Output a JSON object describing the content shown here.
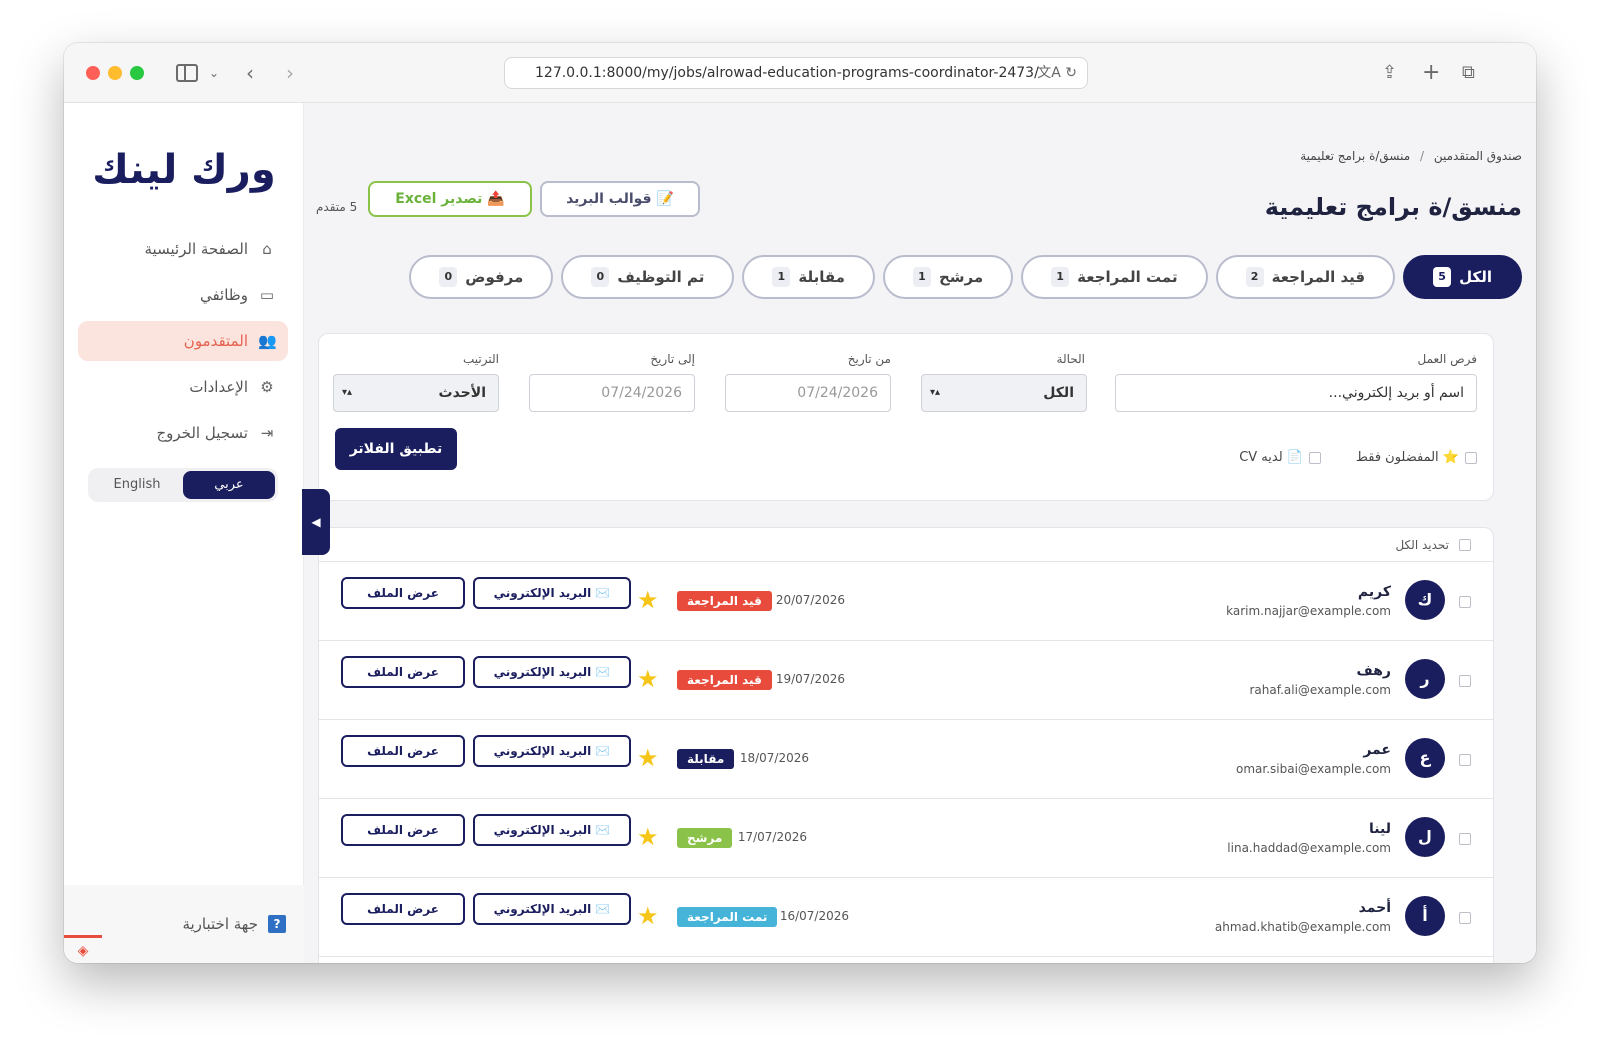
{
  "browser": {
    "url": "127.0.0.1:8000/my/jobs/alrowad-education-programs-coordinator-2473/"
  },
  "sidebar": {
    "logo": "ورك لينك",
    "items": [
      {
        "label": "الصفحة الرئيسية",
        "icon": "home-icon",
        "active": false
      },
      {
        "label": "وظائفي",
        "icon": "briefcase-icon",
        "active": false
      },
      {
        "label": "المتقدمون",
        "icon": "users-icon",
        "active": true
      },
      {
        "label": "الإعدادات",
        "icon": "gear-icon",
        "active": false
      },
      {
        "label": "تسجيل الخروج",
        "icon": "logout-icon",
        "active": false
      }
    ],
    "lang_ar": "عربي",
    "lang_en": "English",
    "footer_label": "جهة اختبارية"
  },
  "header": {
    "breadcrumb_root": "صندوق المتقدمين",
    "breadcrumb_sep": "/",
    "breadcrumb_current": "منسق/ة برامج تعليمية",
    "title": "منسق/ة برامج تعليمية",
    "templates_label": "📝 قوالب البريد",
    "excel_label": "📤 تصدير Excel",
    "count_text": "5 متقدم"
  },
  "tabs": [
    {
      "label": "الكل",
      "count": "5",
      "active": true
    },
    {
      "label": "قيد المراجعة",
      "count": "2",
      "active": false
    },
    {
      "label": "تمت المراجعة",
      "count": "1",
      "active": false
    },
    {
      "label": "مرشح",
      "count": "1",
      "active": false
    },
    {
      "label": "مقابلة",
      "count": "1",
      "active": false
    },
    {
      "label": "تم التوظيف",
      "count": "0",
      "active": false
    },
    {
      "label": "مرفوض",
      "count": "0",
      "active": false
    }
  ],
  "filters": {
    "job_label": "فرص العمل",
    "job_placeholder": "اسم أو بريد إلكتروني...",
    "status_label": "الحالة",
    "status_value": "الكل",
    "from_label": "من تاريخ",
    "from_placeholder": "07/24/2026",
    "to_label": "إلى تاريخ",
    "to_placeholder": "07/24/2026",
    "sort_label": "الترتيب",
    "sort_value": "الأحدث",
    "apply_label": "تطبيق الفلاتر",
    "favorites_label": "⭐ المفضلون فقط",
    "cv_label": "📄 لديه CV"
  },
  "list": {
    "select_all": "تحديد الكل",
    "email_label": "✉️ البريد الإلكتروني",
    "profile_label": "عرض الملف",
    "rows": [
      {
        "initial": "ك",
        "name": "كريم",
        "email": "karim.najjar@example.com",
        "date": "20/07/2026",
        "status": "قيد المراجعة",
        "status_color": "#e84b3c"
      },
      {
        "initial": "ر",
        "name": "رهف",
        "email": "rahaf.ali@example.com",
        "date": "19/07/2026",
        "status": "قيد المراجعة",
        "status_color": "#e84b3c"
      },
      {
        "initial": "ع",
        "name": "عمر",
        "email": "omar.sibai@example.com",
        "date": "18/07/2026",
        "status": "مقابلة",
        "status_color": "#1a1d5e"
      },
      {
        "initial": "ل",
        "name": "لينا",
        "email": "lina.haddad@example.com",
        "date": "17/07/2026",
        "status": "مرشح",
        "status_color": "#8bc34a"
      },
      {
        "initial": "أ",
        "name": "أحمد",
        "email": "ahmad.khatib@example.com",
        "date": "16/07/2026",
        "status": "تمت المراجعة",
        "status_color": "#45b4d8"
      }
    ]
  },
  "colors": {
    "primary": "#1a1d5e",
    "accent": "#e4634e",
    "success": "#8bc34a"
  }
}
